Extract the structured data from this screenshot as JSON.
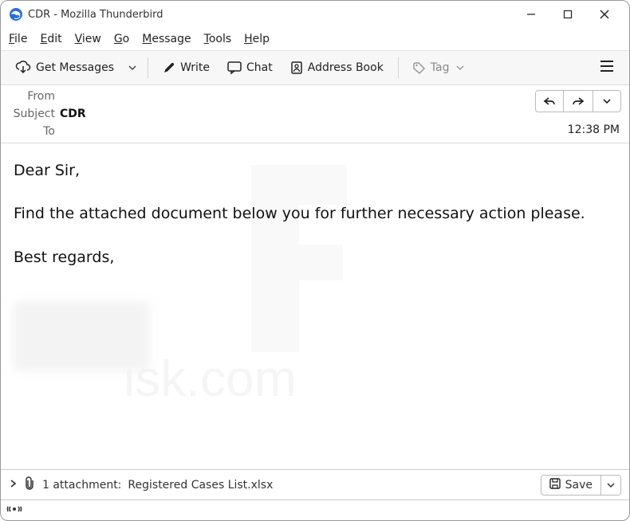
{
  "window": {
    "title": "CDR - Mozilla Thunderbird"
  },
  "menu": {
    "file": "File",
    "file_u": "F",
    "edit": "Edit",
    "edit_u": "E",
    "view": "View",
    "view_u": "V",
    "go": "Go",
    "go_u": "G",
    "message": "Message",
    "message_u": "M",
    "tools": "Tools",
    "tools_u": "T",
    "help": "Help",
    "help_u": "H"
  },
  "toolbar": {
    "get_messages": "Get Messages",
    "write": "Write",
    "chat": "Chat",
    "address_book": "Address Book",
    "tag": "Tag"
  },
  "header": {
    "from_label": "From",
    "from_value": "",
    "subject_label": "Subject",
    "subject_value": "CDR",
    "to_label": "To",
    "to_value": "",
    "time": "12:38 PM"
  },
  "body": {
    "salutation": "Dear Sir,",
    "paragraph": "Find the attached document below you for further necessary action please.",
    "signoff": "Best regards,"
  },
  "attachment": {
    "count_label": "1 attachment:",
    "filename": "Registered Cases List.xlsx",
    "save_label": "Save"
  }
}
